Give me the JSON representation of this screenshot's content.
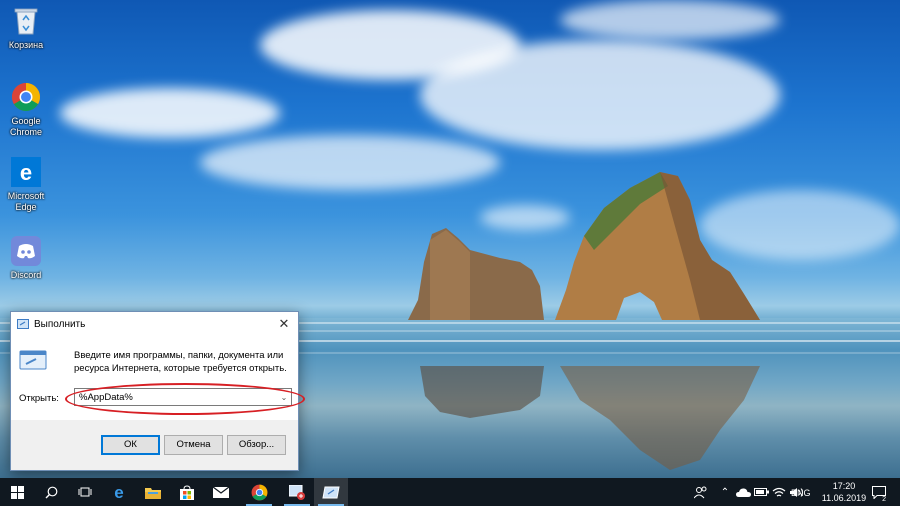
{
  "desktop": {
    "icons": [
      {
        "label": "Корзина",
        "icon": "recycle-bin-icon"
      },
      {
        "label": "Google Chrome",
        "icon": "chrome-icon"
      },
      {
        "label": "Microsoft Edge",
        "icon": "edge-icon"
      },
      {
        "label": "Discord",
        "icon": "discord-icon"
      }
    ]
  },
  "run_dialog": {
    "title": "Выполнить",
    "description": "Введите имя программы, папки, документа или ресурса Интернета, которые требуется открыть.",
    "open_label": "Открыть:",
    "open_value": "%AppData%",
    "ok_label": "ОК",
    "cancel_label": "Отмена",
    "browse_label": "Обзор...",
    "highlight_color": "#d71f24"
  },
  "taskbar": {
    "items": [
      "start-icon",
      "search-icon",
      "task-view-icon",
      "edge-icon",
      "file-explorer-icon",
      "store-icon",
      "mail-icon",
      "chrome-icon",
      "snipping-icon",
      "run-icon"
    ],
    "tray": {
      "language": "ENG",
      "time": "17:20",
      "date": "11.06.2019",
      "notification_count": "2"
    },
    "accent": "#76b9ed"
  }
}
